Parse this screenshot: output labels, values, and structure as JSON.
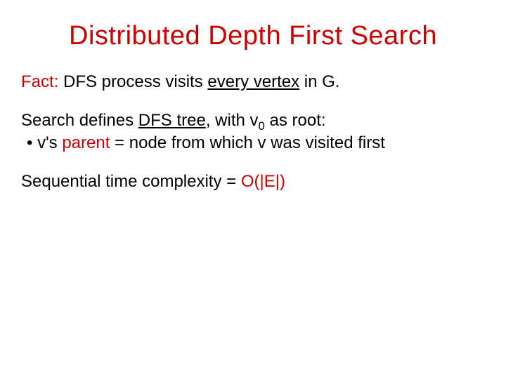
{
  "title": "Distributed Depth First Search",
  "fact": {
    "label": "Fact:",
    "mid1": " DFS process visits ",
    "underline": "every vertex",
    "mid2": " in G."
  },
  "tree": {
    "intro1": "Search defines ",
    "underline": "DFS tree",
    "intro2": ", with v",
    "subscript": "0",
    "intro3": " as root:",
    "bullet_prefix": "• v's ",
    "bullet_red": "parent",
    "bullet_suffix": " = node from which v was visited first"
  },
  "complexity": {
    "prefix": "Sequential time complexity = ",
    "bigO": "O(|E|)"
  }
}
